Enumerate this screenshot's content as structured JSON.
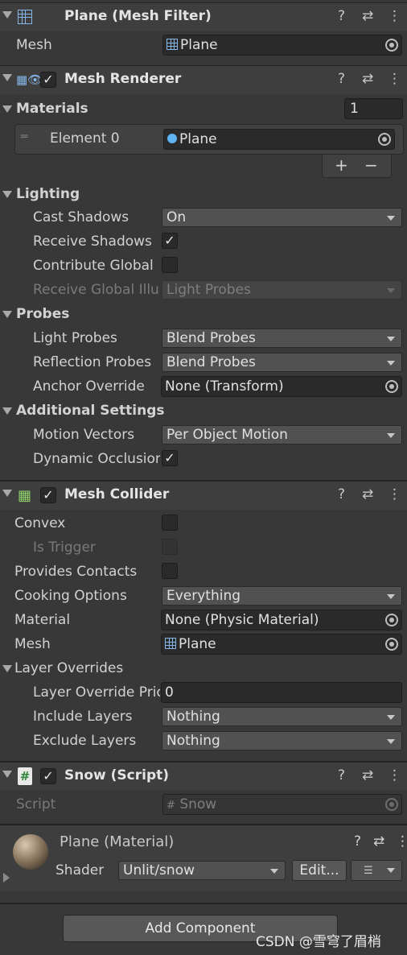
{
  "mesh_filter": {
    "title": "Plane (Mesh Filter)",
    "mesh_label": "Mesh",
    "mesh_value": "Plane"
  },
  "mesh_renderer": {
    "title": "Mesh Renderer",
    "materials_label": "Materials",
    "materials_count": "1",
    "element_label": "Element 0",
    "element_value": "Plane",
    "add_symbol": "+",
    "remove_symbol": "−",
    "lighting_label": "Lighting",
    "cast_shadows_label": "Cast Shadows",
    "cast_shadows_value": "On",
    "receive_shadows_label": "Receive Shadows",
    "receive_shadows_checked": true,
    "contribute_gi_label": "Contribute Global",
    "contribute_gi_checked": false,
    "receive_gi_label": "Receive Global Illu",
    "receive_gi_value": "Light Probes",
    "probes_label": "Probes",
    "light_probes_label": "Light Probes",
    "light_probes_value": "Blend Probes",
    "reflection_probes_label": "Reflection Probes",
    "reflection_probes_value": "Blend Probes",
    "anchor_override_label": "Anchor Override",
    "anchor_override_value": "None (Transform)",
    "additional_label": "Additional Settings",
    "motion_vectors_label": "Motion Vectors",
    "motion_vectors_value": "Per Object Motion",
    "dynamic_occlusion_label": "Dynamic Occlusion",
    "dynamic_occlusion_checked": true
  },
  "mesh_collider": {
    "title": "Mesh Collider",
    "convex_label": "Convex",
    "is_trigger_label": "Is Trigger",
    "provides_contacts_label": "Provides Contacts",
    "cooking_options_label": "Cooking Options",
    "cooking_options_value": "Everything",
    "material_label": "Material",
    "material_value": "None (Physic Material)",
    "mesh_label": "Mesh",
    "mesh_value": "Plane",
    "layer_overrides_label": "Layer Overrides",
    "layer_priority_label": "Layer Override Priority",
    "layer_priority_value": "0",
    "include_layers_label": "Include Layers",
    "include_layers_value": "Nothing",
    "exclude_layers_label": "Exclude Layers",
    "exclude_layers_value": "Nothing"
  },
  "snow_script": {
    "title": "Snow (Script)",
    "script_label": "Script",
    "script_value": "Snow"
  },
  "material": {
    "title": "Plane (Material)",
    "shader_label": "Shader",
    "shader_value": "Unlit/snow",
    "edit_label": "Edit..."
  },
  "add_component_label": "Add Component",
  "watermark": "CSDN @雪穹了眉梢"
}
